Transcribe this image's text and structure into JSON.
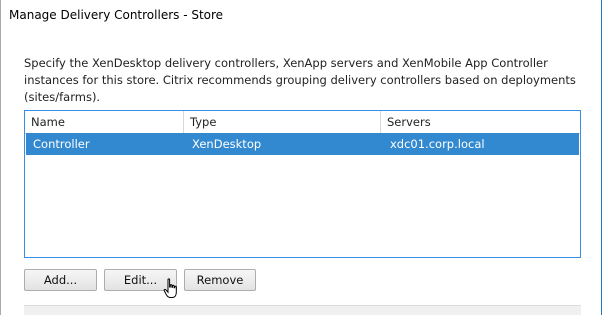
{
  "dialog": {
    "title": "Manage Delivery Controllers - Store",
    "description": "Specify the XenDesktop delivery controllers, XenApp servers and XenMobile App Controller instances for this store. Citrix recommends grouping delivery controllers based on deployments (sites/farms)."
  },
  "table": {
    "columns": [
      "Name",
      "Type",
      "Servers"
    ],
    "rows": [
      {
        "name": "Controller",
        "type": "XenDesktop",
        "servers": "xdc01.corp.local",
        "selected": true
      }
    ]
  },
  "buttons": {
    "add": "Add...",
    "edit": "Edit...",
    "remove": "Remove"
  },
  "colors": {
    "selection": "#3389cf",
    "list_border": "#3a8ee6"
  },
  "icons": {
    "cursor": "hand-pointer-icon"
  }
}
